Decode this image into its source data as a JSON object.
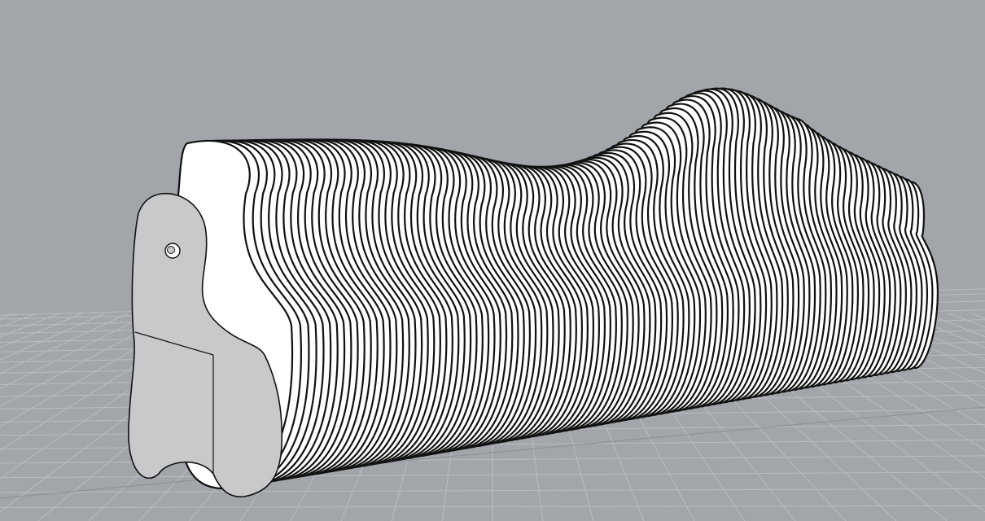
{
  "viewport": {
    "background_color": "#a2a6ab",
    "grid_color": "#b9bcc0",
    "grid_axis_color": "#8f9398",
    "model_fill": "#ffffff",
    "model_edge_color": "#111111",
    "cap_fill": "#c8c9cb"
  },
  "model": {
    "object_type": "sliced-fin-bench",
    "rib_count": 112,
    "rib_style": "waterline-contour"
  }
}
